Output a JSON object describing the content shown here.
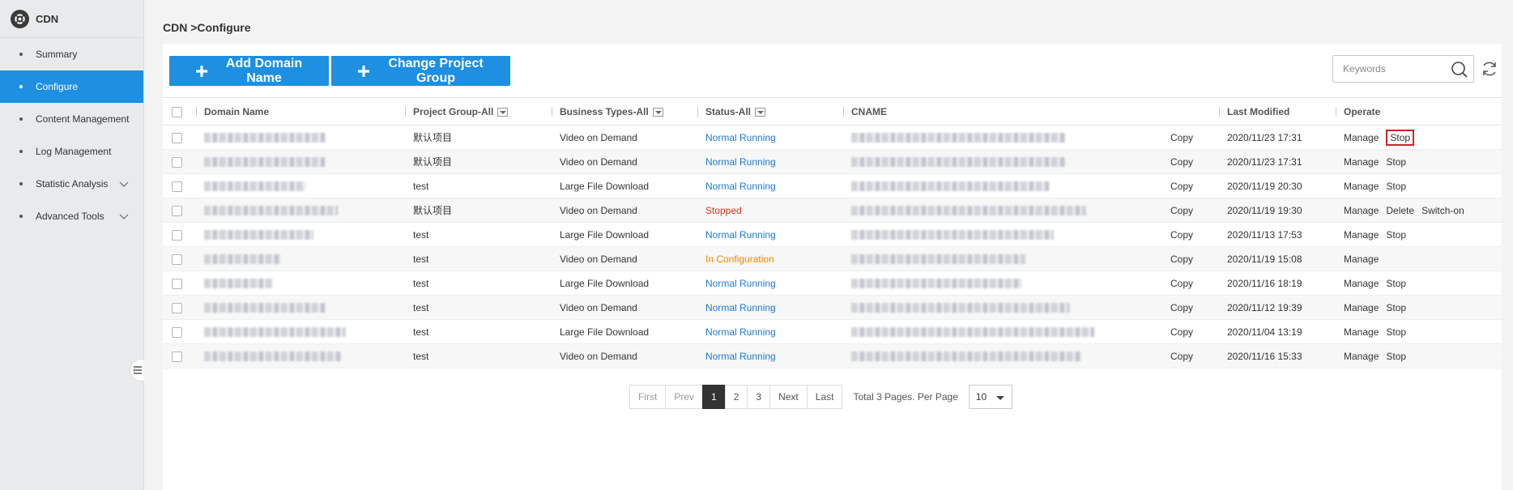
{
  "app": {
    "name": "CDN"
  },
  "sidebar": {
    "items": [
      {
        "label": "Summary",
        "active": false,
        "expandable": false
      },
      {
        "label": "Configure",
        "active": true,
        "expandable": false
      },
      {
        "label": "Content Management",
        "active": false,
        "expandable": false
      },
      {
        "label": "Log Management",
        "active": false,
        "expandable": false
      },
      {
        "label": "Statistic Analysis",
        "active": false,
        "expandable": true
      },
      {
        "label": "Advanced Tools",
        "active": false,
        "expandable": true
      }
    ]
  },
  "breadcrumb": "CDN >Configure",
  "toolbar": {
    "add_domain_label": "Add Domain Name",
    "change_group_label": "Change Project Group",
    "search_placeholder": "Keywords"
  },
  "table": {
    "columns": {
      "domain": "Domain Name",
      "project_group": "Project Group-All",
      "business_types": "Business Types-All",
      "status": "Status-All",
      "cname": "CNAME",
      "last_modified": "Last Modified",
      "operate": "Operate"
    },
    "rows": [
      {
        "project": "默认项目",
        "business": "Video on Demand",
        "status": "Normal Running",
        "status_type": "normal",
        "copy": "Copy",
        "modified": "2020/11/23 17:31",
        "ops": [
          "Manage",
          "Stop"
        ],
        "boxed_op": "Stop"
      },
      {
        "project": "默认项目",
        "business": "Video on Demand",
        "status": "Normal Running",
        "status_type": "normal",
        "copy": "Copy",
        "modified": "2020/11/23 17:31",
        "ops": [
          "Manage",
          "Stop"
        ]
      },
      {
        "project": "test",
        "business": "Large File Download",
        "status": "Normal Running",
        "status_type": "normal",
        "copy": "Copy",
        "modified": "2020/11/19 20:30",
        "ops": [
          "Manage",
          "Stop"
        ]
      },
      {
        "project": "默认项目",
        "business": "Video on Demand",
        "status": "Stopped",
        "status_type": "stopped",
        "copy": "Copy",
        "modified": "2020/11/19 19:30",
        "ops": [
          "Manage",
          "Delete",
          "Switch-on"
        ]
      },
      {
        "project": "test",
        "business": "Large File Download",
        "status": "Normal Running",
        "status_type": "normal",
        "copy": "Copy",
        "modified": "2020/11/13 17:53",
        "ops": [
          "Manage",
          "Stop"
        ]
      },
      {
        "project": "test",
        "business": "Video on Demand",
        "status": "In Configuration",
        "status_type": "config",
        "copy": "Copy",
        "modified": "2020/11/19 15:08",
        "ops": [
          "Manage"
        ]
      },
      {
        "project": "test",
        "business": "Large File Download",
        "status": "Normal Running",
        "status_type": "normal",
        "copy": "Copy",
        "modified": "2020/11/16 18:19",
        "ops": [
          "Manage",
          "Stop"
        ]
      },
      {
        "project": "test",
        "business": "Video on Demand",
        "status": "Normal Running",
        "status_type": "normal",
        "copy": "Copy",
        "modified": "2020/11/12 19:39",
        "ops": [
          "Manage",
          "Stop"
        ]
      },
      {
        "project": "test",
        "business": "Large File Download",
        "status": "Normal Running",
        "status_type": "normal",
        "copy": "Copy",
        "modified": "2020/11/04 13:19",
        "ops": [
          "Manage",
          "Stop"
        ]
      },
      {
        "project": "test",
        "business": "Video on Demand",
        "status": "Normal Running",
        "status_type": "normal",
        "copy": "Copy",
        "modified": "2020/11/16 15:33",
        "ops": [
          "Manage",
          "Stop"
        ]
      }
    ]
  },
  "pagination": {
    "first": "First",
    "prev": "Prev",
    "pages": [
      "1",
      "2",
      "3"
    ],
    "current": "1",
    "next": "Next",
    "last": "Last",
    "info": "Total 3 Pages. Per Page",
    "per_page": "10"
  },
  "colors": {
    "accent": "#1e8fe1",
    "status_normal": "#1e7ad0",
    "status_stopped": "#d9341b",
    "status_config": "#f08a00",
    "highlight_box": "#c7252a"
  }
}
